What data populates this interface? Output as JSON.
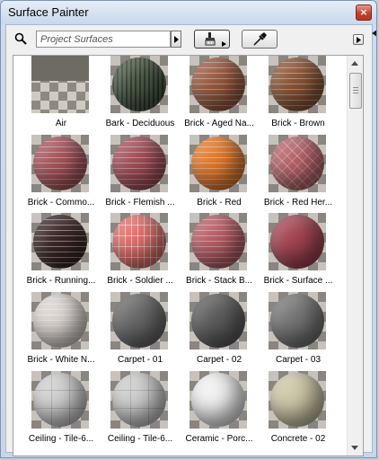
{
  "window": {
    "title": "Surface Painter",
    "close_glyph": "×"
  },
  "toolbar": {
    "search_placeholder": "Project Surfaces",
    "search_icon": "search-icon",
    "dropdown_icon": "triangle-right-icon",
    "paint_icon": "paintbrush-icon",
    "eyedropper_icon": "eyedropper-icon",
    "menu_icon": "triangle-right-icon"
  },
  "surfaces": [
    {
      "label": "Air",
      "color": "#6d6a66",
      "style": "air"
    },
    {
      "label": "Bark - Deciduous",
      "color": "#4f5e49",
      "style": "bark"
    },
    {
      "label": "Brick - Aged Na...",
      "color": "#9a5a40",
      "style": "brick"
    },
    {
      "label": "Brick - Brown",
      "color": "#8c5535",
      "style": "brick"
    },
    {
      "label": "Brick - Commo...",
      "color": "#a8555c",
      "style": "brick"
    },
    {
      "label": "Brick - Flemish ...",
      "color": "#a34f58",
      "style": "brick"
    },
    {
      "label": "Brick - Red",
      "color": "#e47a2c",
      "style": "brick"
    },
    {
      "label": "Brick - Red Her...",
      "color": "#b8646a",
      "style": "herring"
    },
    {
      "label": "Brick - Running...",
      "color": "#3a2626",
      "style": "brickdark"
    },
    {
      "label": "Brick - Soldier ...",
      "color": "#e0706c",
      "style": "soldier"
    },
    {
      "label": "Brick - Stack B...",
      "color": "#b85e66",
      "style": "brick"
    },
    {
      "label": "Brick - Surface ...",
      "color": "#a44552",
      "style": "plain"
    },
    {
      "label": "Brick - White N...",
      "color": "#ddd6d2",
      "style": "brick"
    },
    {
      "label": "Carpet - 01",
      "color": "#6a6a6a",
      "style": "plain"
    },
    {
      "label": "Carpet - 02",
      "color": "#5e5e5e",
      "style": "plain"
    },
    {
      "label": "Carpet - 03",
      "color": "#777777",
      "style": "plain"
    },
    {
      "label": "Ceiling - Tile-6...",
      "color": "#d2d2d2",
      "style": "tile"
    },
    {
      "label": "Ceiling - Tile-6...",
      "color": "#cfcfcf",
      "style": "tile"
    },
    {
      "label": "Ceramic - Porc...",
      "color": "#f2f2f2",
      "style": "plain"
    },
    {
      "label": "Concrete - 02",
      "color": "#cfc9a8",
      "style": "plain"
    }
  ],
  "colors": {
    "title_bar": "#cfdcec",
    "panel": "#f0f0f0",
    "grid_bg": "#ffffff",
    "close_button": "#c4412b"
  }
}
